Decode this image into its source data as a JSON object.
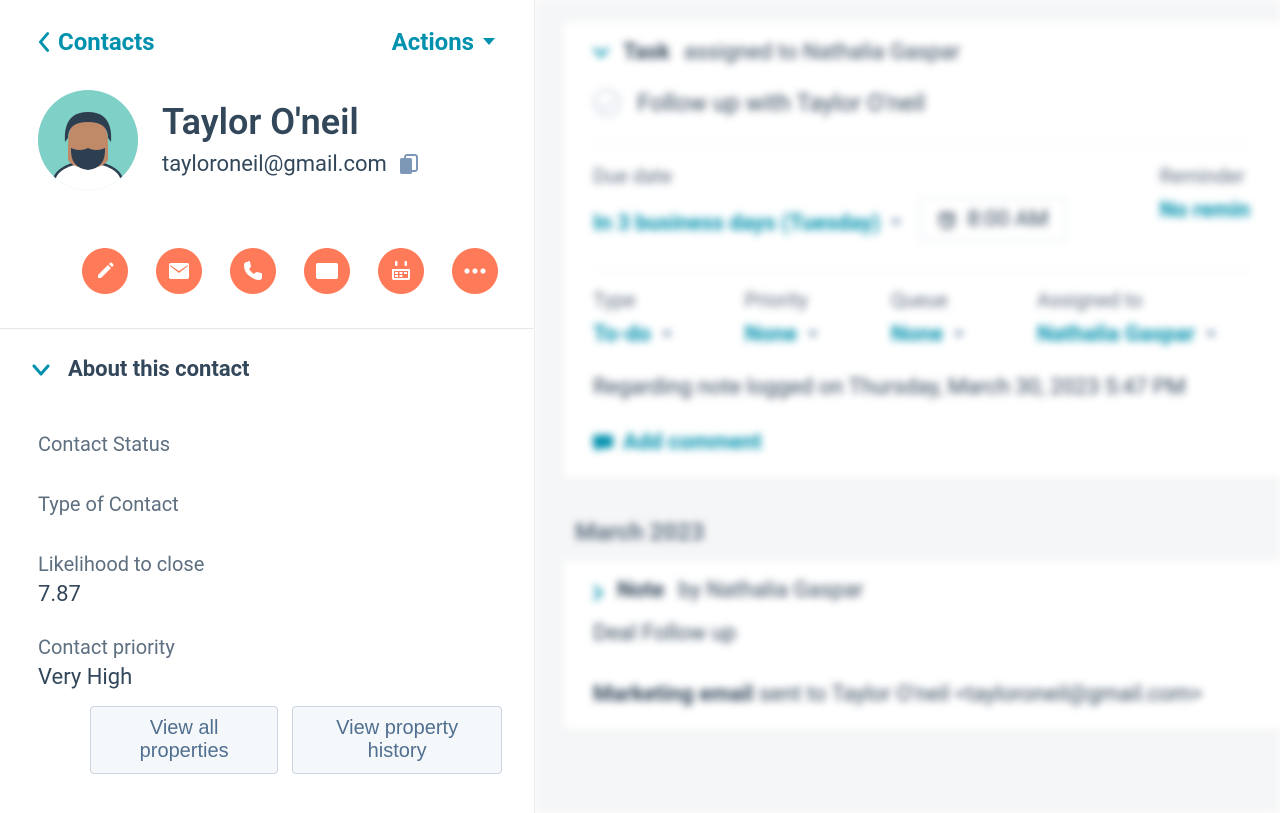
{
  "header": {
    "back_label": "Contacts",
    "actions_label": "Actions"
  },
  "contact": {
    "name": "Taylor O'neil",
    "email": "tayloroneil@gmail.com"
  },
  "about": {
    "title": "About this contact",
    "fields": {
      "contact_status_label": "Contact Status",
      "type_of_contact_label": "Type of Contact",
      "likelihood_label": "Likelihood to close",
      "likelihood_value": "7.87",
      "priority_label": "Contact priority",
      "priority_value": "Very High"
    },
    "buttons": {
      "view_all": "View all properties",
      "view_history": "View property history"
    }
  },
  "timeline": {
    "task": {
      "label_task": "Task",
      "label_assigned_to": "assigned to Nathalia Gaspar",
      "title": "Follow up with Taylor O'neil",
      "due_date_label": "Due date",
      "due_date_value": "In 3 business days (Tuesday)",
      "time_value": "8:00 AM",
      "reminder_label": "Reminder",
      "reminder_value": "No remin",
      "type_label": "Type",
      "type_value": "To-do",
      "priority_label": "Priority",
      "priority_value": "None",
      "queue_label": "Queue",
      "queue_value": "None",
      "assigned_label": "Assigned to",
      "assigned_value": "Nathalia Gaspar",
      "regarding": "Regarding note logged on Thursday, March 30, 2023 5:47 PM",
      "add_comment": "Add comment"
    },
    "month": "March 2023",
    "note": {
      "label_note": "Note",
      "by_text": "by Nathalia Gaspar",
      "body": "Deal Follow up"
    },
    "marketing_email": {
      "label": "Marketing email",
      "rest": "sent to Taylor O'neil <tayloroneil@gmail.com>"
    }
  }
}
